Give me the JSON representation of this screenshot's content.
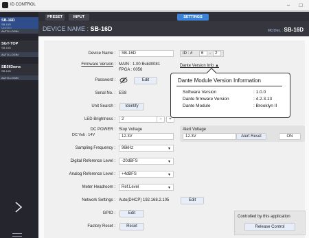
{
  "titlebar": {
    "title": "ID CONTROL",
    "minimize": "–",
    "maximize": "□"
  },
  "sidebar": {
    "devices": [
      {
        "name": "SB-16D",
        "model": "SB-16D",
        "mode": "UNITED",
        "login": "AUTO-LOGIN",
        "active": true
      },
      {
        "name": "SGY-TOP",
        "model": "SB-16D",
        "mode": "",
        "login": "AUTO-LOGIN",
        "active": false
      },
      {
        "name": "SB563oms",
        "model": "SB-16D",
        "mode": "",
        "login": "AUTO-LOGIN",
        "active": false
      }
    ]
  },
  "tabs": {
    "preset": "PRESET",
    "input": "INPUT",
    "settings": "SETTINGS"
  },
  "header": {
    "device_name_label": "DEVICE NAME : ",
    "device_name": "SB-16D",
    "model_label": "MODEL : ",
    "model": "SB-16D"
  },
  "settings": {
    "device_name_label": "Device Name :",
    "device_name_value": "SB-16D",
    "id_label": "ID : #",
    "id_value_1": "6",
    "id_dash": "-",
    "id_value_2": "2",
    "firmware_label": "Firmware Version",
    "firmware_colon": ":",
    "firmware_main": "MAIN : 1.00 Build0081",
    "firmware_fpga": "FPGA : 0056",
    "dante_info_link": "Dante Version Info ▲",
    "password_label": "Password :",
    "password_edit": "Edit",
    "serial_label": "Serial No. :",
    "serial_value": "ES8",
    "unit_search_label": "Unit Search :",
    "unit_search_btn": "Identify",
    "led_label": "LED Brightness :",
    "led_value": "2",
    "led_minus": "−",
    "led_plus": "+",
    "dc_power_label": "DC POWER :",
    "dc_volt_label": "DC Volt : 14V",
    "stop_voltage_label": "Stop Voltage",
    "stop_voltage_value": "12.3V",
    "alert_voltage_label": "Alert Voltage",
    "alert_voltage_value": "12.3V",
    "alert_reset": "Alert Reset",
    "alert_on": "ON",
    "sampling_label": "Sampling Frequency :",
    "sampling_value": "96kHz",
    "digital_ref_label": "Digital Reference Level :",
    "digital_ref_value": "-20dBFS",
    "analog_ref_label": "Analog Reference Level :",
    "analog_ref_value": "+4dBFS",
    "meter_label": "Meter Headroom :",
    "meter_value": "Ref.Level",
    "network_label": "Network Settings :",
    "network_value": "Auto(DHCP) 192.168.2.105",
    "network_edit": "Edit",
    "gpio_label": "GPIO :",
    "gpio_edit": "Edit",
    "factory_label": "Factory Reset :",
    "factory_btn": "Reset",
    "controlled_text": "Controlled by this application",
    "release_btn": "Release Control"
  },
  "dante_popup": {
    "title": "Dante Module Version Information",
    "rows": [
      {
        "label": "Software Version",
        "value": ": 1.0.0"
      },
      {
        "label": "Dante firmware Version",
        "value": ": 4.2.3.13"
      },
      {
        "label": "Dante Module",
        "value": ": Brooklyn II"
      }
    ]
  },
  "icons": {
    "eye": "eye-icon",
    "chevron": "chevron-right-icon",
    "menu": "hamburger-menu-icon",
    "caret": "dropdown-caret-icon"
  },
  "colors": {
    "accent": "#3d82d4",
    "sidebar_bg": "#24252d",
    "header_bg": "#35363e",
    "active_device": "#2f4d8a"
  }
}
